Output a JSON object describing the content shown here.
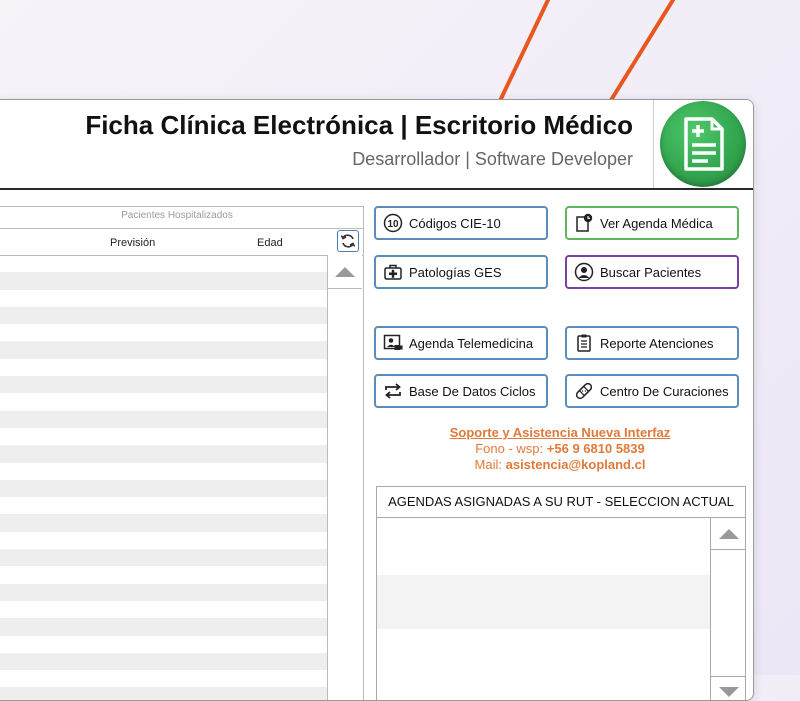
{
  "header": {
    "title_a": "Ficha Clínica Electrónica",
    "separator": "|",
    "title_b": "Escritorio Médico",
    "subtitle": "Desarrollador | Software Developer",
    "logo_icon": "medical-document-icon"
  },
  "patients_table": {
    "caption": "Pacientes Hospitalizados",
    "columns": [
      "Previsión",
      "Edad"
    ],
    "refresh_icon": "refresh-icon"
  },
  "buttons": [
    {
      "label": "Códigos CIE-10",
      "icon": "number-10-icon"
    },
    {
      "label": "Ver Agenda Médica",
      "icon": "agenda-clock-icon"
    },
    {
      "label": "Patologías GES",
      "icon": "medical-kit-icon"
    },
    {
      "label": "Buscar Pacientes",
      "icon": "user-icon"
    },
    {
      "label": "Agenda Telemedicina",
      "icon": "video-call-icon"
    },
    {
      "label": "Reporte Atenciones",
      "icon": "clipboard-icon"
    },
    {
      "label": "Base De Datos Ciclos",
      "icon": "cycle-arrows-icon"
    },
    {
      "label": "Centro De Curaciones",
      "icon": "bandage-icon"
    }
  ],
  "support": {
    "title": "Soporte y Asistencia Nueva Interfaz",
    "phone_label": "Fono - wsp:",
    "phone": "+56 9 6810 5839",
    "mail_label": "Mail:",
    "mail": "asistencia@kopland.cl"
  },
  "agendas": {
    "title": "AGENDAS ASIGNADAS A SU RUT - SELECCION ACTUAL"
  },
  "colors": {
    "accent_blue": "#5b8db8",
    "accent_green": "#5cb85c",
    "accent_purple": "#7a3fa3",
    "support_orange": "#e07a3a",
    "logo_green": "#33a64f"
  }
}
